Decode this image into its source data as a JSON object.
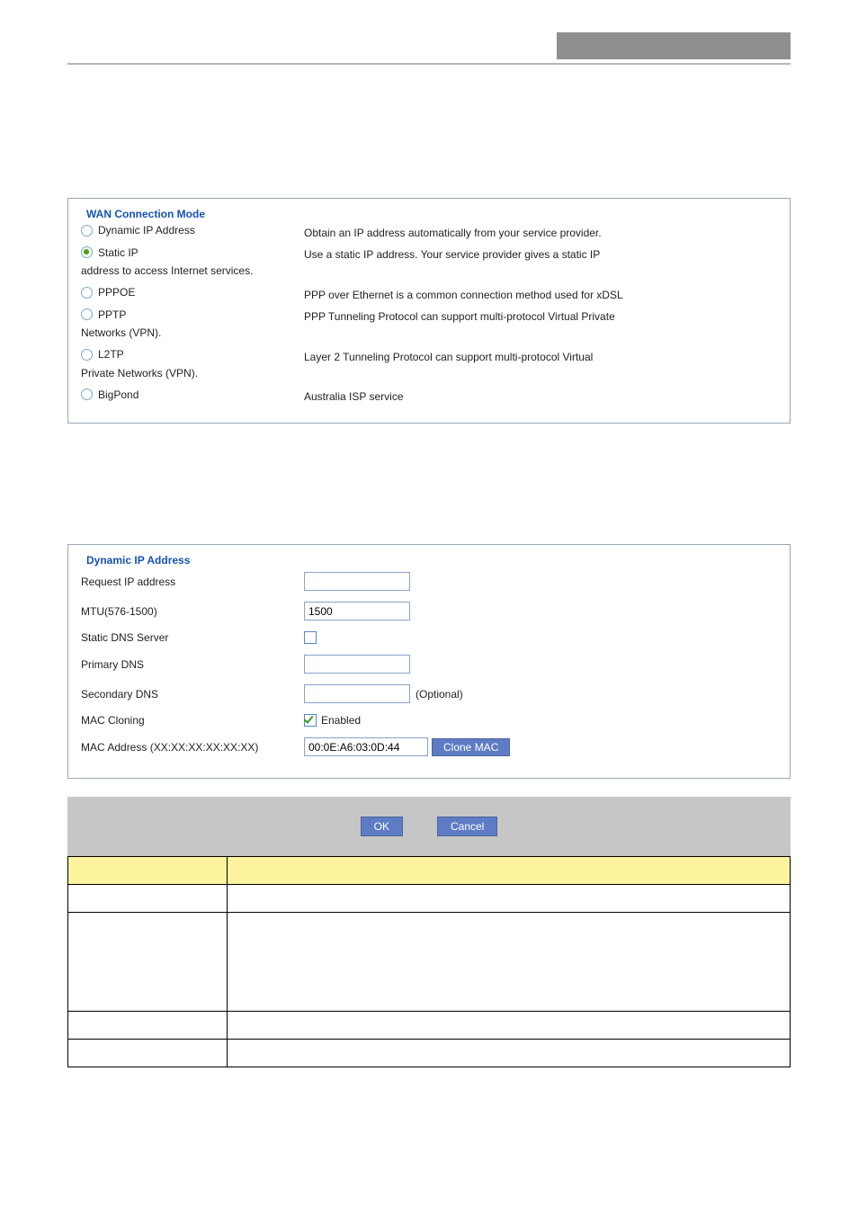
{
  "wan": {
    "legend": "WAN Connection Mode",
    "options": [
      {
        "label": "Dynamic IP Address",
        "desc": "Obtain an IP address automatically from your service provider."
      },
      {
        "label": "Static IP",
        "desc_line1": "Use a static IP address. Your service provider gives a static IP",
        "desc_line2": "address to access Internet services."
      },
      {
        "label": "PPPOE",
        "desc": "PPP over Ethernet is a common connection method used for xDSL"
      },
      {
        "label": "PPTP",
        "desc_line1": "PPP Tunneling Protocol can support multi-protocol Virtual Private",
        "desc_line2": "Networks (VPN)."
      },
      {
        "label": "L2TP",
        "desc_line1": "Layer 2 Tunneling Protocol can support multi-protocol Virtual",
        "desc_line2": "Private Networks (VPN)."
      },
      {
        "label": "BigPond",
        "desc": "Australia ISP service"
      }
    ],
    "selected": "Static IP"
  },
  "dyn": {
    "legend": "Dynamic IP Address",
    "fields": {
      "request_ip": "Request IP address",
      "mtu": "MTU(576-1500)",
      "static_dns": "Static DNS Server",
      "primary_dns": "Primary DNS",
      "secondary_dns": "Secondary DNS",
      "optional": "(Optional)",
      "mac_cloning": "MAC Cloning",
      "enabled": "Enabled",
      "mac_address": "MAC Address (XX:XX:XX:XX:XX:XX)"
    },
    "values": {
      "mtu": "1500",
      "mac": "00:0E:A6:03:0D:44",
      "static_dns_checked": false,
      "mac_cloning_checked": true
    },
    "clone_mac_btn": "Clone MAC"
  },
  "actions": {
    "ok": "OK",
    "cancel": "Cancel"
  }
}
